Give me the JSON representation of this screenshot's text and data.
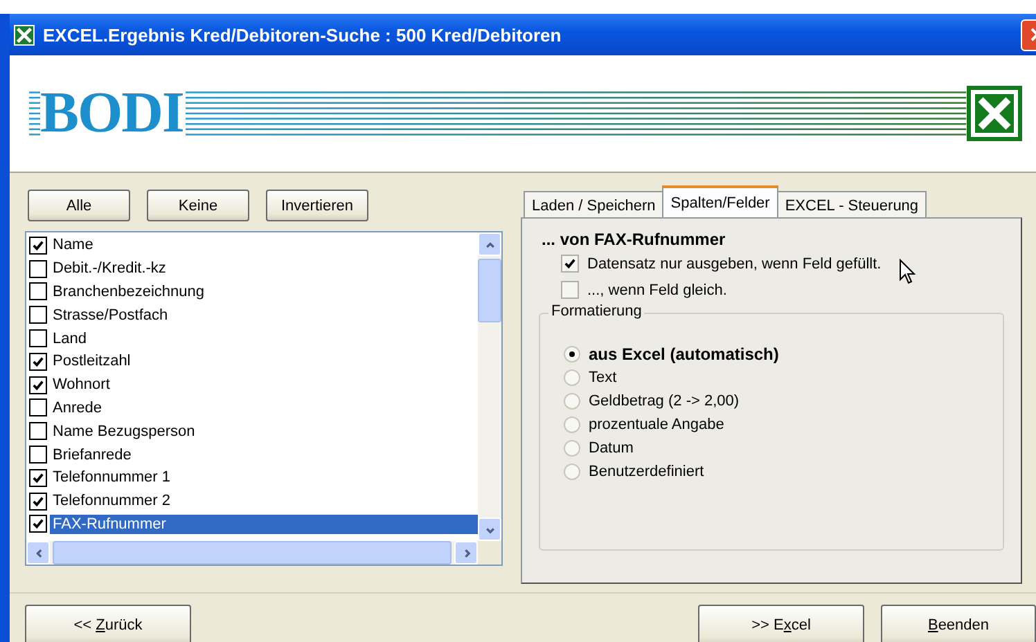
{
  "window": {
    "title": "EXCEL.Ergebnis Kred/Debitoren-Suche : 500 Kred/Debitoren"
  },
  "header": {
    "logo": "BODI"
  },
  "selection_buttons": [
    "Alle",
    "Keine",
    "Invertieren"
  ],
  "fields": [
    {
      "label": "Name",
      "checked": true,
      "selected": false
    },
    {
      "label": "Debit.-/Kredit.-kz",
      "checked": false,
      "selected": false
    },
    {
      "label": "Branchenbezeichnung",
      "checked": false,
      "selected": false
    },
    {
      "label": "Strasse/Postfach",
      "checked": false,
      "selected": false
    },
    {
      "label": "Land",
      "checked": false,
      "selected": false
    },
    {
      "label": "Postleitzahl",
      "checked": true,
      "selected": false
    },
    {
      "label": "Wohnort",
      "checked": true,
      "selected": false
    },
    {
      "label": "Anrede",
      "checked": false,
      "selected": false
    },
    {
      "label": "Name Bezugsperson",
      "checked": false,
      "selected": false
    },
    {
      "label": "Briefanrede",
      "checked": false,
      "selected": false
    },
    {
      "label": "Telefonnummer 1",
      "checked": true,
      "selected": false
    },
    {
      "label": "Telefonnummer 2",
      "checked": true,
      "selected": false
    },
    {
      "label": "FAX-Rufnummer",
      "checked": true,
      "selected": true
    }
  ],
  "tabs": [
    {
      "label": "Laden / Speichern",
      "selected": false
    },
    {
      "label": "Spalten/Felder",
      "selected": true
    },
    {
      "label": "EXCEL - Steuerung",
      "selected": false
    }
  ],
  "panel": {
    "heading": "... von FAX-Rufnummer",
    "options": [
      {
        "label": "Datensatz nur ausgeben, wenn Feld gefüllt.",
        "checked": true
      },
      {
        "label": "..., wenn Feld gleich.",
        "checked": false
      }
    ],
    "format_group": {
      "title": "Formatierung",
      "choices": [
        {
          "label": "aus Excel (automatisch)",
          "selected": true
        },
        {
          "label": "Text",
          "selected": false
        },
        {
          "label": "Geldbetrag (2 -> 2,00)",
          "selected": false
        },
        {
          "label": "prozentuale Angabe",
          "selected": false
        },
        {
          "label": "Datum",
          "selected": false
        },
        {
          "label": "Benutzerdefiniert",
          "selected": false
        }
      ]
    }
  },
  "footer_buttons": [
    {
      "before": "<< ",
      "key": "Z",
      "after": "urück"
    },
    {
      "before": ">> E",
      "key": "x",
      "after": "cel"
    },
    {
      "key": "B",
      "after": "eenden"
    }
  ]
}
